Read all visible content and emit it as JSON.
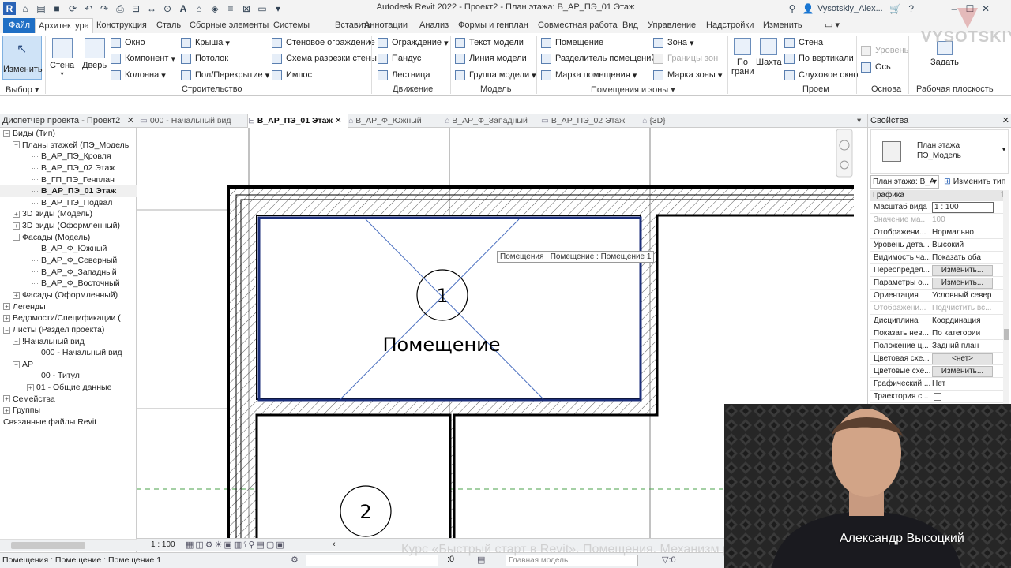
{
  "app": {
    "title": "Autodesk Revit 2022 - Проект2 - План этажа: В_АР_ПЭ_01 Этаж",
    "user": "Vysotskiy_Alex..."
  },
  "ribbon_tabs": [
    "Файл",
    "Архитектура",
    "Конструкция",
    "Сталь",
    "Сборные элементы",
    "Системы",
    "Вставить",
    "Аннотации",
    "Анализ",
    "Формы и генплан",
    "Совместная работа",
    "Вид",
    "Управление",
    "Надстройки",
    "Изменить"
  ],
  "ribbon": {
    "modify": "Изменить",
    "select": "Выбор",
    "wall": "Стена",
    "door": "Дверь",
    "window": "Окно",
    "component": "Компонент",
    "column": "Колонна",
    "roof": "Крыша",
    "ceiling": "Потолок",
    "floor": "Пол/Перекрытие",
    "curtain_wall": "Стеновое ограждение",
    "curtain_grid": "Схема разрезки стены",
    "mullion": "Импост",
    "build_label": "Строительство",
    "railing": "Ограждение",
    "ramp": "Пандус",
    "stair": "Лестница",
    "circulation_label": "Движение",
    "model_text": "Текст модели",
    "model_line": "Линия модели",
    "model_group": "Группа модели",
    "model_label": "Модель",
    "room": "Помещение",
    "room_separator": "Разделитель помещений",
    "room_tag": "Марка помещения",
    "area": "Зона",
    "area_boundary": "Границы зон",
    "area_tag": "Марка зоны",
    "rooms_label": "Помещения и зоны",
    "by_face": "По грани",
    "shaft": "Шахта",
    "op_wall": "Стена",
    "vertical": "По вертикали",
    "dormer": "Слуховое окно",
    "opening_label": "Проем",
    "level": "Уровень",
    "grid": "Ось",
    "datum_label": "Основа",
    "set": "Задать",
    "workplane_label": "Рабочая плоскость"
  },
  "project_browser": {
    "title": "Диспетчер проекта - Проект2",
    "items": [
      {
        "text": "Виды (Тип)",
        "t": "−",
        "bold": false
      },
      {
        "text": "Планы этажей (ПЭ_Модель",
        "t": "−",
        "bold": false
      },
      {
        "text": "В_АР_ПЭ_Кровля",
        "t": "",
        "bold": false
      },
      {
        "text": "В_АР_ПЭ_02 Этаж",
        "t": "",
        "bold": false
      },
      {
        "text": "В_ГП_ПЭ_Генплан",
        "t": "",
        "bold": false
      },
      {
        "text": "В_АР_ПЭ_01 Этаж",
        "t": "",
        "bold": true
      },
      {
        "text": "В_АР_ПЭ_Подвал",
        "t": "",
        "bold": false
      },
      {
        "text": "3D виды (Модель)",
        "t": "+",
        "bold": false
      },
      {
        "text": "3D виды (Оформленный)",
        "t": "+",
        "bold": false
      },
      {
        "text": "Фасады (Модель)",
        "t": "−",
        "bold": false
      },
      {
        "text": "В_АР_Ф_Южный",
        "t": "",
        "bold": false
      },
      {
        "text": "В_АР_Ф_Северный",
        "t": "",
        "bold": false
      },
      {
        "text": "В_АР_Ф_Западный",
        "t": "",
        "bold": false
      },
      {
        "text": "В_АР_Ф_Восточный",
        "t": "",
        "bold": false
      },
      {
        "text": "Фасады (Оформленный)",
        "t": "+",
        "bold": false
      },
      {
        "text": "Легенды",
        "t": "+",
        "bold": false
      },
      {
        "text": "Ведомости/Спецификации (",
        "t": "+",
        "bold": false
      },
      {
        "text": "Листы (Раздел проекта)",
        "t": "−",
        "bold": false
      },
      {
        "text": "!Начальный вид",
        "t": "−",
        "bold": false
      },
      {
        "text": "000 - Начальный вид",
        "t": "",
        "bold": false
      },
      {
        "text": "АР",
        "t": "−",
        "bold": false
      },
      {
        "text": "00 - Титул",
        "t": "",
        "bold": false
      },
      {
        "text": "01 - Общие данные",
        "t": "+",
        "bold": false
      },
      {
        "text": "Семейства",
        "t": "+",
        "bold": false
      },
      {
        "text": "Группы",
        "t": "+",
        "bold": false
      },
      {
        "text": "Связанные файлы Revit",
        "t": "",
        "bold": false
      }
    ]
  },
  "view_tabs": [
    "000 - Начальный вид",
    "В_АР_ПЭ_01 Этаж",
    "В_АР_Ф_Южный",
    "В_АР_Ф_Западный",
    "В_АР_ПЭ_02 Этаж",
    "{3D}"
  ],
  "canvas": {
    "tooltip": "Помещения : Помещение : Помещение 1",
    "room_name": "Помещение",
    "tag1": "1",
    "tag2": "2"
  },
  "viewbar": {
    "scale": "1 : 100"
  },
  "statusbar": {
    "selection": "Помещения : Помещение : Помещение 1",
    "coord": ":0",
    "model": "Главная модель"
  },
  "properties": {
    "title": "Свойства",
    "type_line1": "План этажа",
    "type_line2": "ПЭ_Модель",
    "selector": "План этажа: В_А",
    "edit_type": "Изменить тип",
    "group": "Графика",
    "rows": [
      {
        "k": "Масштаб вида",
        "v": "1 : 100",
        "kind": "input"
      },
      {
        "k": "Значение ма...",
        "v": "100",
        "kind": "dis"
      },
      {
        "k": "Отображени...",
        "v": "Нормально",
        "kind": "text"
      },
      {
        "k": "Уровень дета...",
        "v": "Высокий",
        "kind": "text"
      },
      {
        "k": "Видимость ча...",
        "v": "Показать оба",
        "kind": "text"
      },
      {
        "k": "Переопредел...",
        "v": "Изменить...",
        "kind": "btn"
      },
      {
        "k": "Параметры о...",
        "v": "Изменить...",
        "kind": "btn"
      },
      {
        "k": "Ориентация",
        "v": "Условный север",
        "kind": "text"
      },
      {
        "k": "Отображени...",
        "v": "Подчистить вс...",
        "kind": "dis"
      },
      {
        "k": "Дисциплина",
        "v": "Координация",
        "kind": "text"
      },
      {
        "k": "Показать нев...",
        "v": "По категории",
        "kind": "text"
      },
      {
        "k": "Положение ц...",
        "v": "Задний план",
        "kind": "text"
      },
      {
        "k": "Цветовая схе...",
        "v": "<нет>",
        "kind": "btn"
      },
      {
        "k": "Цветовые схе...",
        "v": "Изменить...",
        "kind": "btn"
      },
      {
        "k": "Графический ...",
        "v": "Нет",
        "kind": "text"
      },
      {
        "k": "Траектория с...",
        "v": "",
        "kind": "check"
      }
    ]
  },
  "overlay": {
    "presenter": "Александр Высоцкий",
    "subtitle": "Курс «Быстрый старт в Revit». Помещения. Механизм работы. Размещение. Марки",
    "watermark": "VYSOTSKIY"
  },
  "colors": {
    "file_tab": "#1f6fc5",
    "room_boundary": "#1b2e7a",
    "room_cross": "#4a6fc0"
  }
}
